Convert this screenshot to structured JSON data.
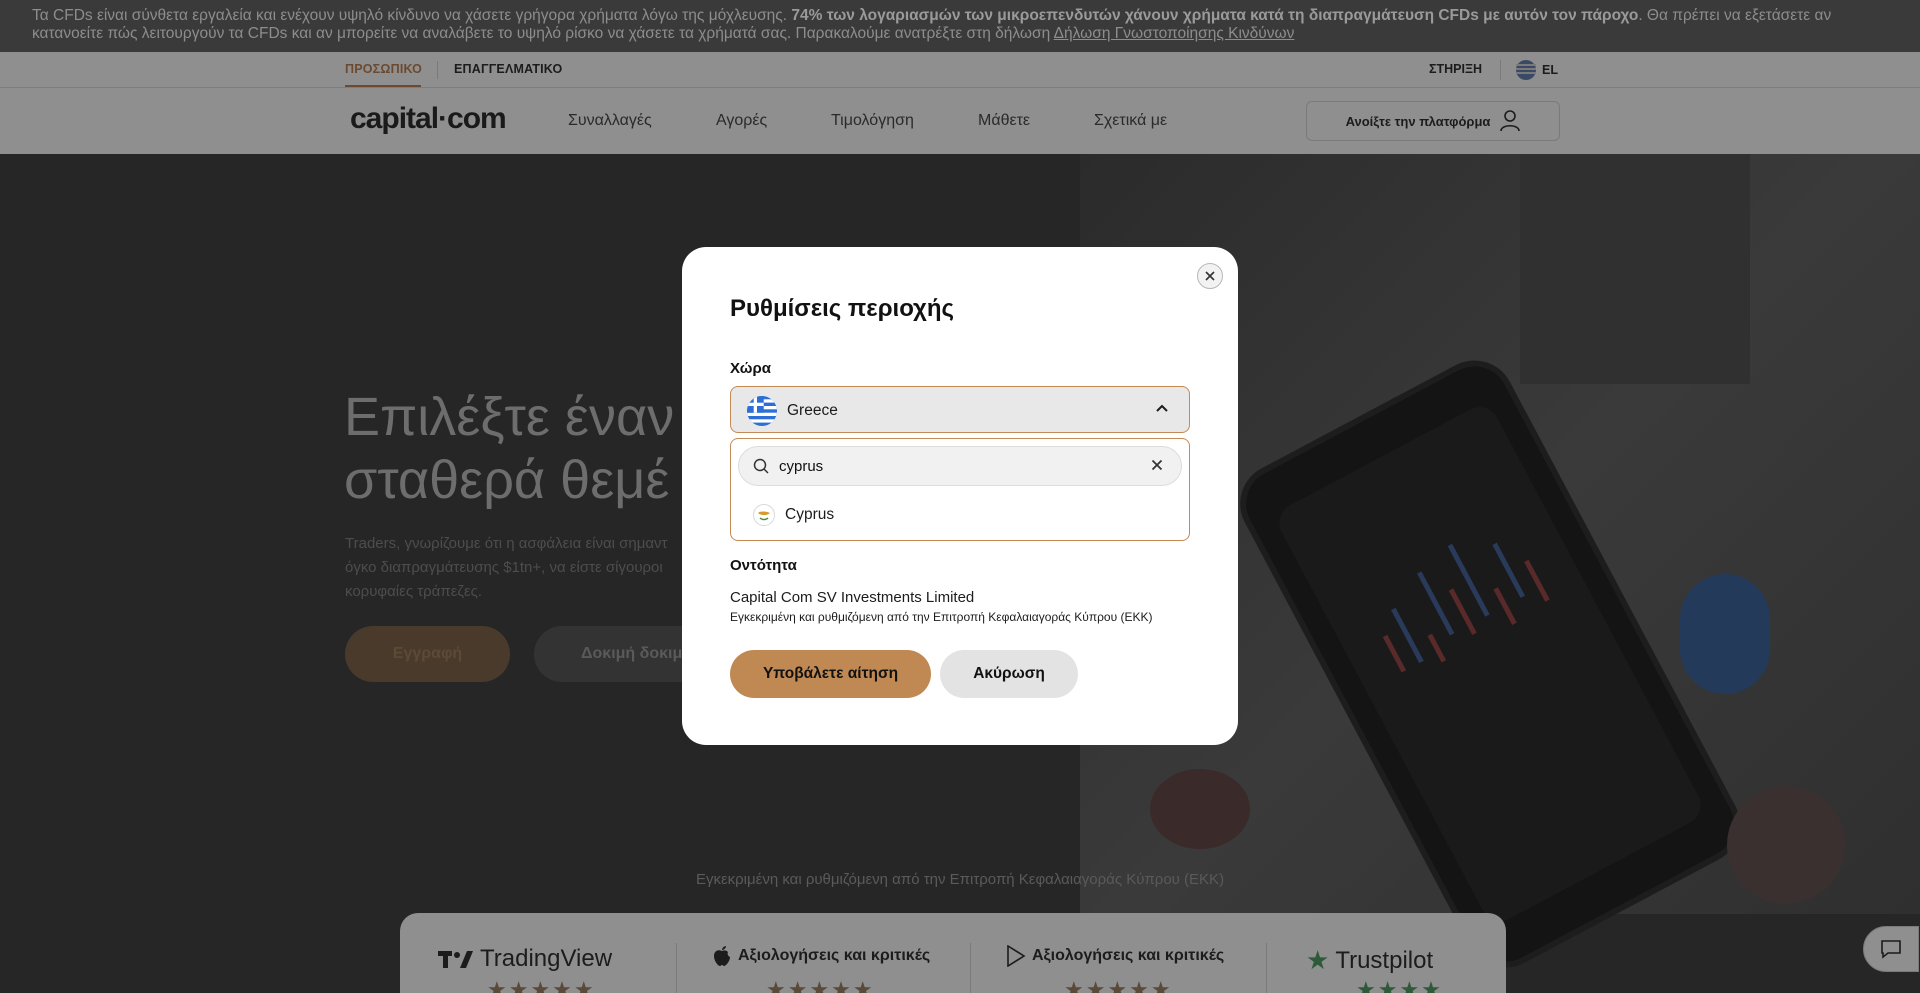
{
  "risk_banner": {
    "text_before": "Τα CFDs είναι σύνθετα εργαλεία και ενέχουν υψηλό κίνδυνο να χάσετε γρήγορα χρήματα λόγω της μόχλευσης. ",
    "text_bold": "74% των λογαριασμών των μικροεπενδυτών χάνουν χρήματα κατά τη διαπραγμάτευση CFDs με αυτόν τον πάροχο",
    "text_after": ". Θα πρέπει να εξετάσετε αν κατανοείτε πώς λειτουργούν τα CFDs και αν μπορείτε να αναλάβετε το υψηλό ρίσκο να χάσετε τα χρήματά σας. Παρακαλούμε ανατρέξτε στη δήλωση ",
    "link": "Δήλωση Γνωστοποίησης Κινδύνων"
  },
  "topbar": {
    "segment_personal": "ΠΡΟΣΩΠΙΚΟ",
    "segment_professional": "ΕΠΑΓΓΕΛΜΑΤΙΚΟ",
    "support": "ΣΤΗΡΙΞΗ",
    "language": "EL"
  },
  "nav": {
    "logo": "capital·com",
    "items": [
      "Συναλλαγές",
      "Αγορές",
      "Τιμολόγηση",
      "Μάθετε",
      "Σχετικά με"
    ],
    "open_platform": "Ανοίξτε την πλατφόρμα"
  },
  "hero": {
    "title_line1": "Επιλέξτε έναν",
    "title_line2": "σταθερά θεμέ",
    "sub_line1": "Traders, γνωρίζουμε ότι η ασφάλεια είναι σημαντ",
    "sub_line2": "όγκο διαπραγμάτευσης $1tn+, να είστε σίγουροι",
    "sub_line3": "κορυφαίες τράπεζες.",
    "signup_button": "Εγγραφή",
    "demo_button": "Δοκιμή δοκιμ",
    "regulator_text": "Εγκεκριμένη και ρυθμιζόμενη από την Επιτροπή Κεφαλαιαγοράς Κύπρου (ΕΚΚ)"
  },
  "ratings": {
    "tradingview": "TradingView",
    "appstore_label": "Αξιολογήσεις και κριτικές",
    "googleplay_label": "Αξιολογήσεις και κριτικές",
    "trustpilot": "Trustpilot"
  },
  "modal": {
    "title": "Ρυθμίσεις περιοχής",
    "country_label": "Χώρα",
    "selected_country": "Greece",
    "search_value": "cyprus",
    "option": "Cyprus",
    "entity_label": "Οντότητα",
    "entity_name": "Capital Com SV Investments Limited",
    "entity_desc": "Εγκεκριμένη και ρυθμιζόμενη από την Επιτροπή Κεφαλαιαγοράς Κύπρου (ΕΚΚ)",
    "submit_button": "Υποβάλετε αίτηση",
    "cancel_button": "Ακύρωση"
  },
  "colors": {
    "accent": "#c08953",
    "select_border": "#c58a53",
    "overlay": "rgba(0,0,0,0.55)"
  },
  "icons": {
    "close": "close-icon",
    "chevron": "chevron-up-icon",
    "search": "search-icon",
    "clear": "clear-icon",
    "user": "user-icon",
    "chat": "chat-icon"
  }
}
